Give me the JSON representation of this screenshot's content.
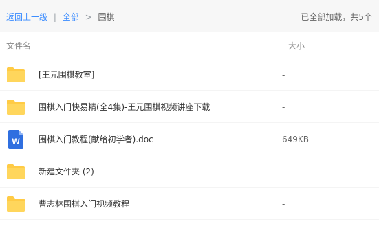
{
  "breadcrumb": {
    "back": "返回上一级",
    "divider": "|",
    "all": "全部",
    "arrow": ">",
    "current": "围棋"
  },
  "status": "已全部加载，共5个",
  "columns": {
    "name": "文件名",
    "size": "大小"
  },
  "files": [
    {
      "icon": "folder-icon",
      "name": "[王元围棋教室]",
      "size": "-"
    },
    {
      "icon": "folder-icon",
      "name": "围棋入门快易精(全4集)-王元围棋视频讲座下载",
      "size": "-"
    },
    {
      "icon": "word-doc-icon",
      "name": "围棋入门教程(献给初学者).doc",
      "size": "649KB"
    },
    {
      "icon": "folder-icon",
      "name": "新建文件夹 (2)",
      "size": "-"
    },
    {
      "icon": "folder-icon",
      "name": "曹志林围棋入门视频教程",
      "size": "-"
    }
  ],
  "colors": {
    "link": "#3b8cff",
    "folder": "#ffcb45",
    "word": "#2f6fe0"
  },
  "doc_glyph": "W"
}
